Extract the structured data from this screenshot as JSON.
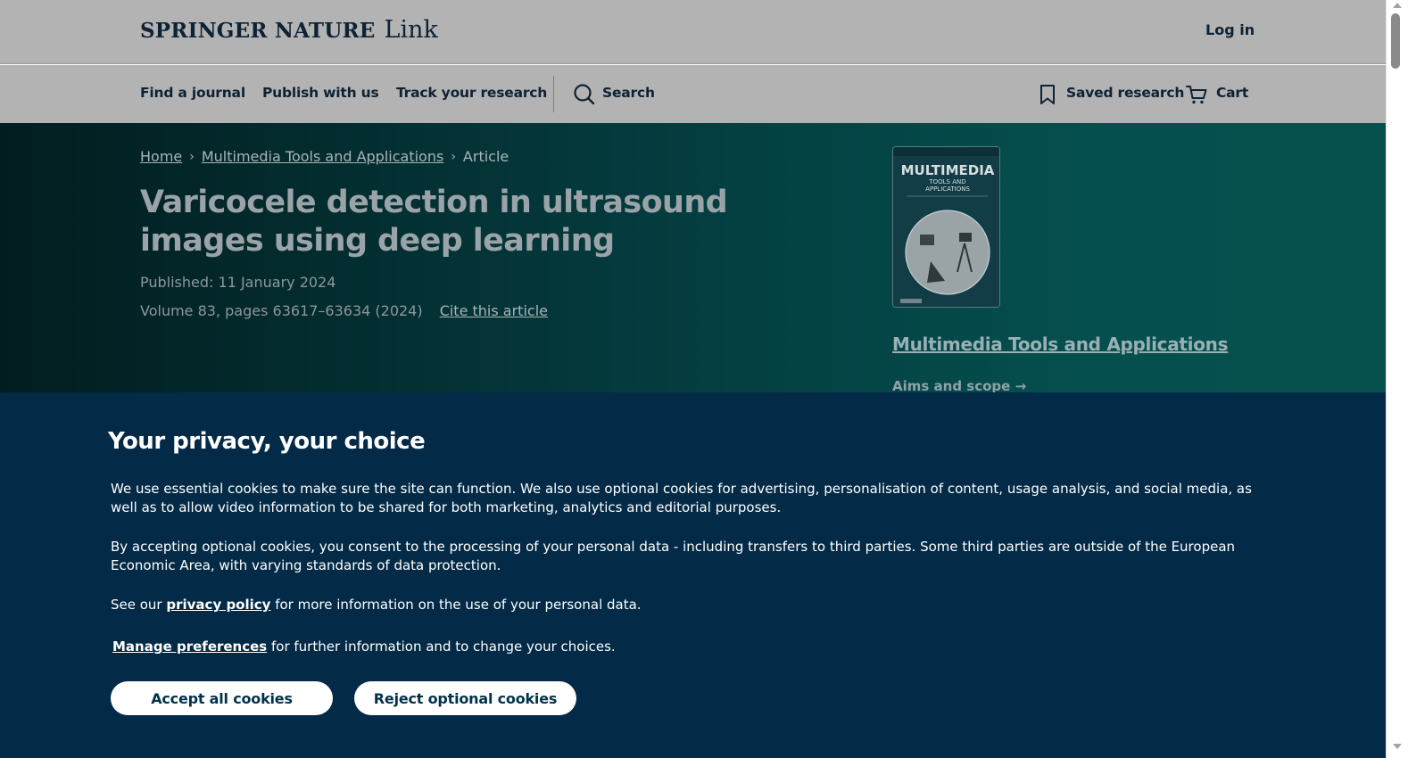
{
  "header": {
    "logo_word": "SPRINGER NATURE",
    "logo_link": "Link",
    "login_label": "Log in"
  },
  "nav": {
    "find_journal": "Find a journal",
    "publish": "Publish with us",
    "track": "Track your research",
    "search": "Search",
    "saved_research": "Saved research",
    "cart": "Cart"
  },
  "breadcrumb": {
    "home": "Home",
    "journal": "Multimedia Tools and Applications",
    "current": "Article"
  },
  "article": {
    "title": "Varicocele detection in ultrasound images using deep learning",
    "published": "Published: 11 January 2024",
    "volume": "Volume 83, pages 63617–63634 (2024)",
    "cite_label": "Cite this article"
  },
  "journal_panel": {
    "cover_title_line1": "MULTIMEDIA",
    "cover_title_line2": "TOOLS AND",
    "cover_title_line3": "APPLICATIONS",
    "journal_name": "Multimedia Tools and Applications",
    "aims_label": "Aims and scope"
  },
  "cookie": {
    "title": "Your privacy, your choice",
    "p1": "We use essential cookies to make sure the site can function. We also use optional cookies for advertising, personalisation of content, usage analysis, and social media, as well as to allow video information to be shared for both marketing, analytics and editorial purposes.",
    "p2": "By accepting optional cookies, you consent to the processing of your personal data - including transfers to third parties. Some third parties are outside of the European Economic Area, with varying standards of data protection.",
    "p3_prefix": "See our ",
    "p3_link": "privacy policy",
    "p3_suffix": " for more information on the use of your personal data.",
    "p4_link": "Manage preferences",
    "p4_suffix": " for further information and to change your choices.",
    "accept_label": "Accept all cookies",
    "reject_label": "Reject optional cookies"
  },
  "colors": {
    "header_bg": "#b3b3b3",
    "hero_dark": "#021d1f",
    "hero_teal": "#06504e",
    "cookie_bg": "#032a46",
    "button_text": "#01324b"
  },
  "icons": {
    "search": "search-icon",
    "bookmark": "bookmark-icon",
    "cart": "cart-icon",
    "breadcrumb_sep": "chevron-right-icon",
    "aims_arrow": "arrow-right-icon"
  }
}
